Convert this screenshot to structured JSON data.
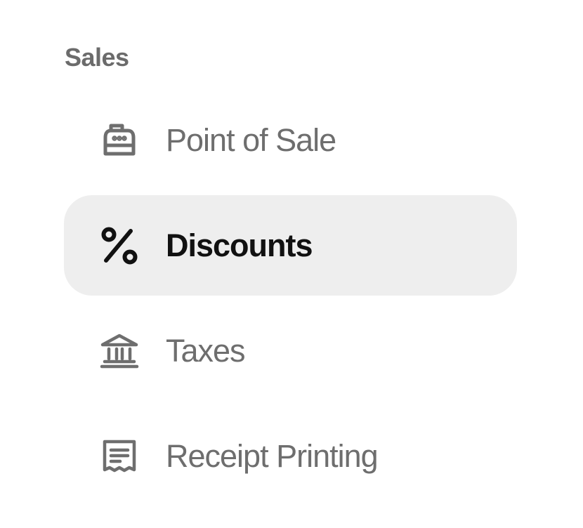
{
  "section": {
    "title": "Sales"
  },
  "nav": {
    "items": [
      {
        "label": "Point of Sale",
        "icon": "cash-register-icon",
        "active": false
      },
      {
        "label": "Discounts",
        "icon": "percent-icon",
        "active": true
      },
      {
        "label": "Taxes",
        "icon": "bank-icon",
        "active": false
      },
      {
        "label": "Receipt Printing",
        "icon": "receipt-icon",
        "active": false
      }
    ]
  },
  "colors": {
    "section_title": "#6b6b6b",
    "inactive_text": "#6e6e6e",
    "active_text": "#111111",
    "active_background": "#eeeeee",
    "background": "#ffffff"
  }
}
